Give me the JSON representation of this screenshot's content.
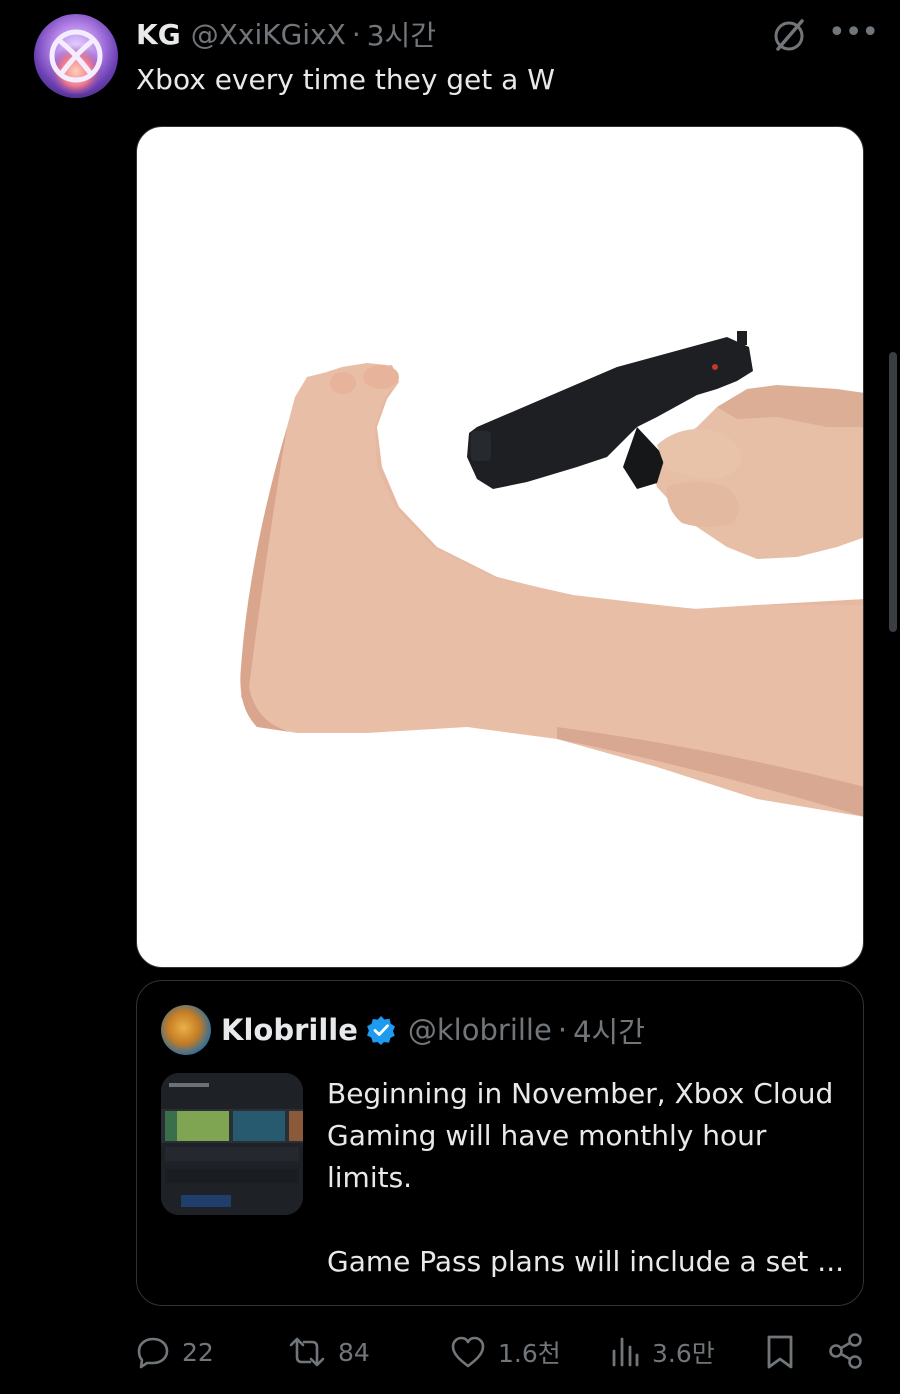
{
  "tweet": {
    "display_name": "KG",
    "handle": "@XxiKGixX",
    "separator": "·",
    "time": "3시간",
    "text": "Xbox every time they get a W",
    "avatar_icon": "xbox-logo-avatar",
    "media_description_icon": "meme-image"
  },
  "quoted_tweet": {
    "display_name": "Klobrille",
    "verified": true,
    "handle": "@klobrille",
    "separator": "·",
    "time": "4시간",
    "text": "Beginning in November, Xbox Cloud\nGaming will have monthly hour\nlimits.\n\nGame Pass plans will include a set ..."
  },
  "actions": {
    "replies": "22",
    "reposts": "84",
    "likes": "1.6천",
    "views": "3.6만"
  },
  "colors": {
    "background": "#000000",
    "text_primary": "#e7e9ea",
    "text_secondary": "#71767b",
    "border": "#2f3336",
    "verified_blue": "#1d9bf0"
  }
}
